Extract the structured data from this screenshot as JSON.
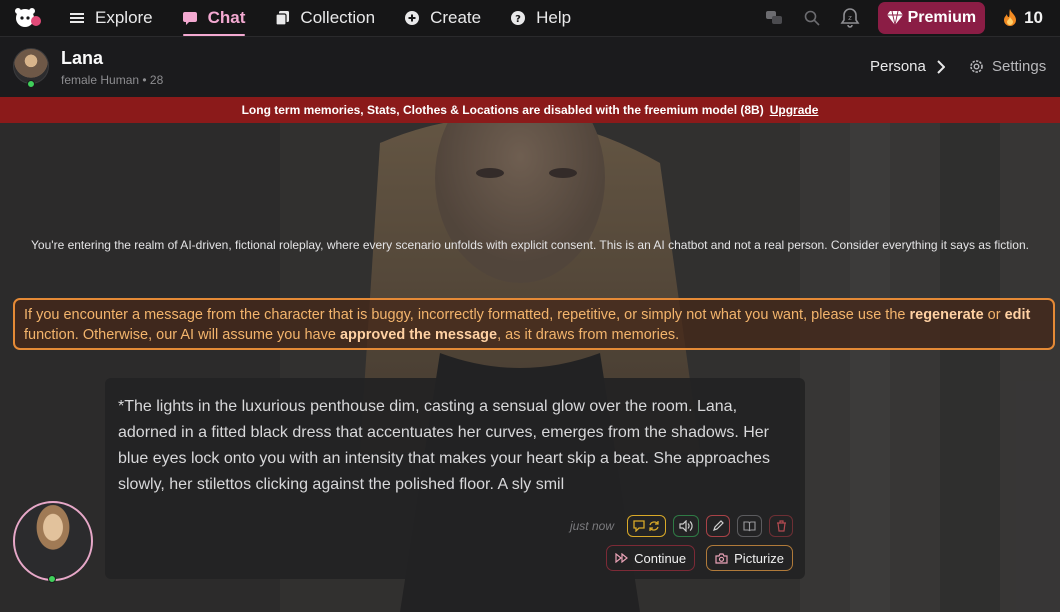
{
  "nav": {
    "items": [
      {
        "label": "Explore",
        "icon": "list-icon"
      },
      {
        "label": "Chat",
        "icon": "chat-bubble-icon",
        "active": true
      },
      {
        "label": "Collection",
        "icon": "collection-icon"
      },
      {
        "label": "Create",
        "icon": "plus-circle-icon"
      },
      {
        "label": "Help",
        "icon": "help-circle-icon"
      }
    ],
    "premium_label": "Premium",
    "coins": "10",
    "accent": "#f3a9d1",
    "premium_color": "#8b1d45"
  },
  "character": {
    "name": "Lana",
    "meta": "female Human • 28",
    "persona_label": "Persona",
    "settings_label": "Settings"
  },
  "banner": {
    "text": "Long term memories, Stats, Clothes & Locations are disabled with the freemium model (8B)",
    "link": "Upgrade",
    "color": "#8b1a1a"
  },
  "chat": {
    "disclaimer": "You're entering the realm of AI-driven, fictional roleplay, where every scenario unfolds with explicit consent. This is an AI chatbot and not a real person. Consider everything it says as fiction.",
    "notice": {
      "p1": "If you encounter a message from the character that is buggy, incorrectly formatted, repetitive, or simply not what you want, please use the ",
      "b1": "regenerate",
      "p2": " or ",
      "b2": "edit",
      "p3": " function. Otherwise, our AI will assume you have ",
      "b3": "approved the message",
      "p4": ", as it draws from memories."
    },
    "message": {
      "text": "*The lights in the luxurious penthouse dim, casting a sensual glow over the room. Lana, adorned in a fitted black dress that accentuates her curves, emerges from the shadows. Her blue eyes lock onto you with an intensity that makes your heart skip a beat. She approaches slowly, her stilettos clicking against the polished floor. A sly smil",
      "timestamp": "just now",
      "continue_label": "Continue",
      "picturize_label": "Picturize"
    }
  }
}
